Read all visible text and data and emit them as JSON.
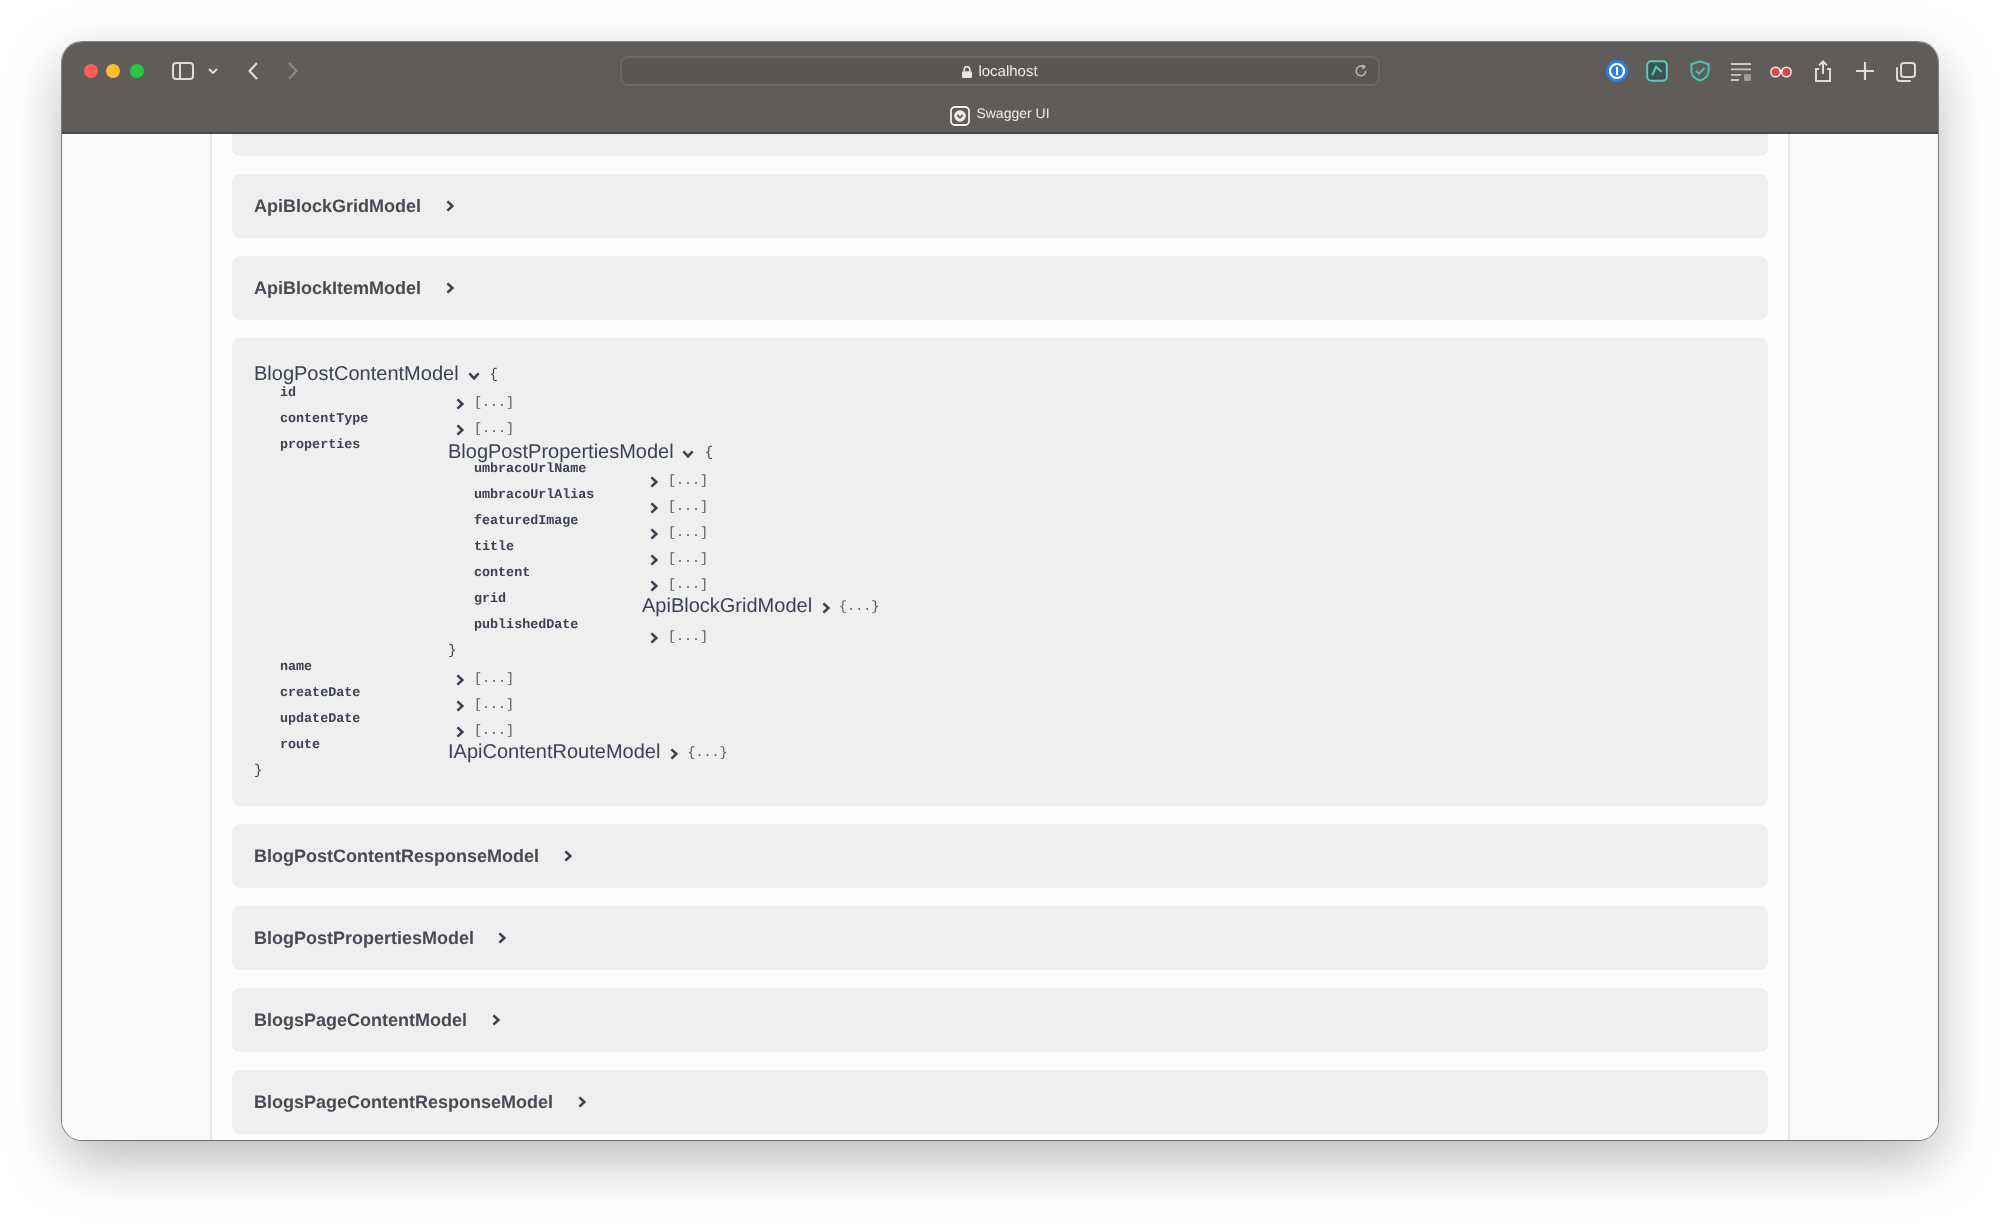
{
  "browser": {
    "back_disabled": false,
    "forward_disabled": true,
    "address": "localhost",
    "tab_title": "Swagger UI"
  },
  "models": [
    {
      "name": "ApiBlockGridModel",
      "expanded": false
    },
    {
      "name": "ApiBlockItemModel",
      "expanded": false
    },
    {
      "name": "BlogPostContentModel",
      "expanded": true,
      "open_brace": "{",
      "close_brace": "}",
      "properties": [
        {
          "name": "id",
          "kind": "array",
          "expanded": false,
          "summary": "[...]"
        },
        {
          "name": "contentType",
          "kind": "array",
          "expanded": false,
          "summary": "[...]"
        },
        {
          "name": "properties",
          "kind": "model",
          "model": {
            "name": "BlogPostPropertiesModel",
            "expanded": true,
            "open_brace": "{",
            "close_brace": "}",
            "properties": [
              {
                "name": "umbracoUrlName",
                "kind": "array",
                "expanded": false,
                "summary": "[...]"
              },
              {
                "name": "umbracoUrlAlias",
                "kind": "array",
                "expanded": false,
                "summary": "[...]"
              },
              {
                "name": "featuredImage",
                "kind": "array",
                "expanded": false,
                "summary": "[...]"
              },
              {
                "name": "title",
                "kind": "array",
                "expanded": false,
                "summary": "[...]"
              },
              {
                "name": "content",
                "kind": "array",
                "expanded": false,
                "summary": "[...]"
              },
              {
                "name": "grid",
                "kind": "model",
                "model": {
                  "name": "ApiBlockGridModel",
                  "expanded": false,
                  "summary": "{...}"
                }
              },
              {
                "name": "publishedDate",
                "kind": "array",
                "expanded": false,
                "summary": "[...]"
              }
            ]
          }
        },
        {
          "name": "name",
          "kind": "array",
          "expanded": false,
          "summary": "[...]"
        },
        {
          "name": "createDate",
          "kind": "array",
          "expanded": false,
          "summary": "[...]"
        },
        {
          "name": "updateDate",
          "kind": "array",
          "expanded": false,
          "summary": "[...]"
        },
        {
          "name": "route",
          "kind": "model",
          "model": {
            "name": "IApiContentRouteModel",
            "expanded": false,
            "summary": "{...}"
          }
        }
      ]
    },
    {
      "name": "BlogPostContentResponseModel",
      "expanded": false
    },
    {
      "name": "BlogPostPropertiesModel",
      "expanded": false
    },
    {
      "name": "BlogsPageContentModel",
      "expanded": false
    },
    {
      "name": "BlogsPageContentResponseModel",
      "expanded": false
    }
  ]
}
